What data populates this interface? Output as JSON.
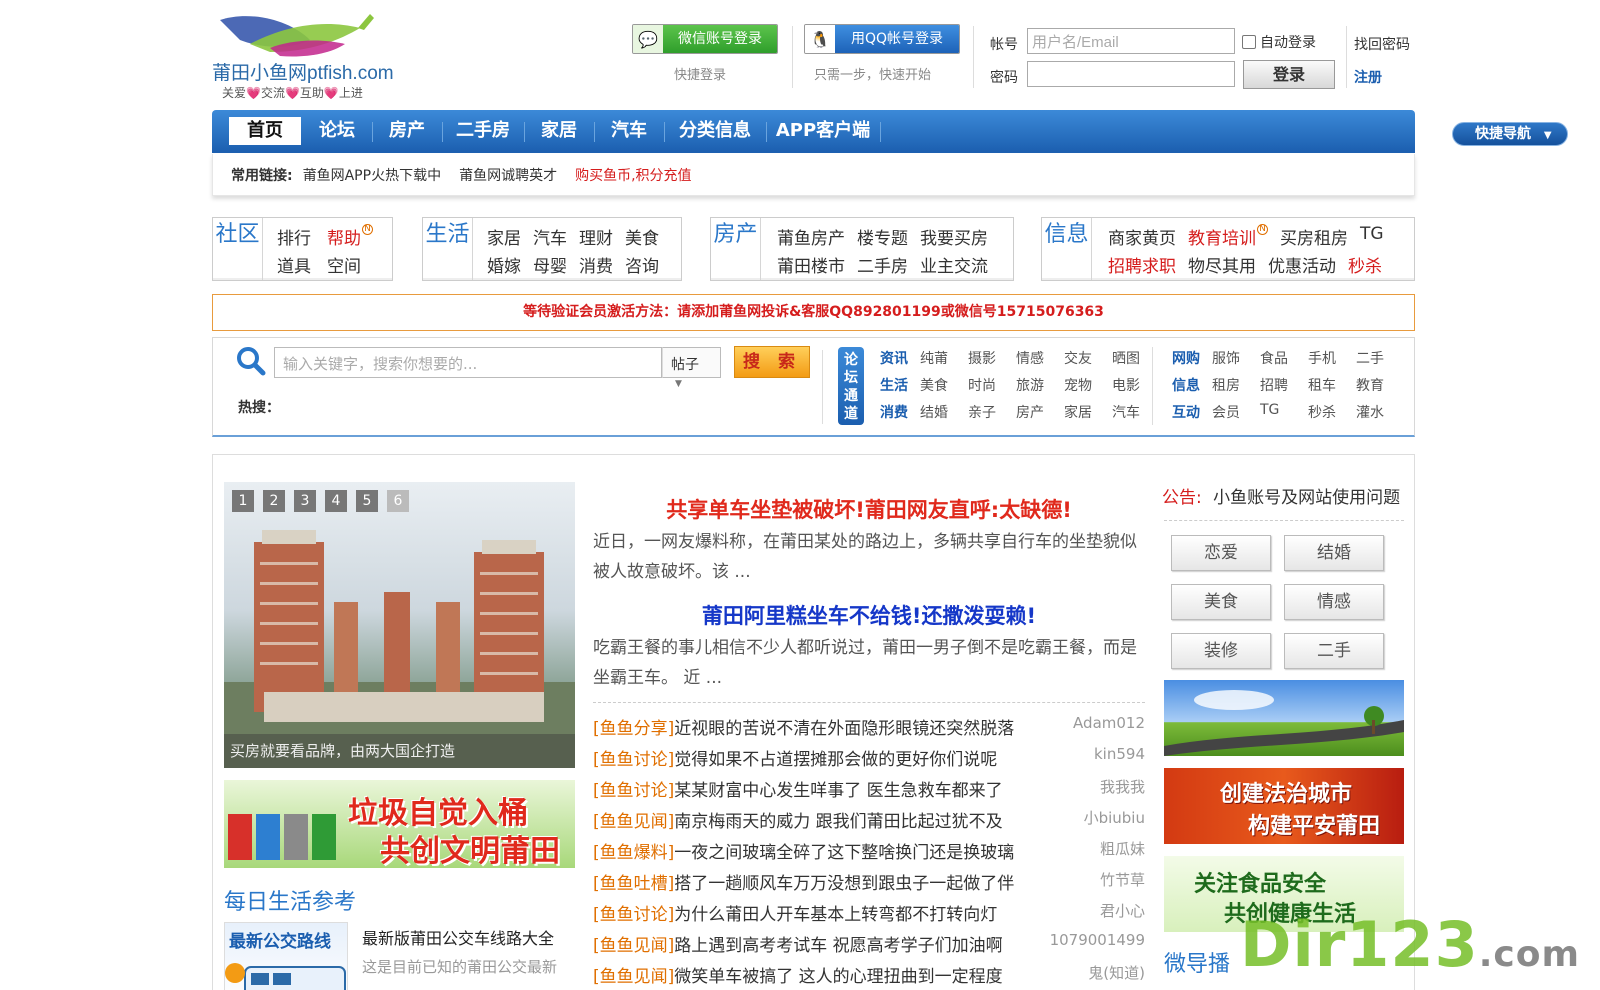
{
  "logo": {
    "text": "莆田小鱼网ptfish.com",
    "slogan": "关爱💗交流💗互助💗上进"
  },
  "login": {
    "wechat_label": "微信账号登录",
    "wechat_hint": "快捷登录",
    "qq_label": "用QQ帐号登录",
    "qq_hint": "只需一步，快速开始",
    "account_label": "帐号",
    "account_placeholder": "用户名/Email",
    "password_label": "密码",
    "auto_login": "自动登录",
    "login_btn": "登录",
    "forgot": "找回密码",
    "register": "注册"
  },
  "nav": {
    "items": [
      "首页",
      "论坛",
      "房产",
      "二手房",
      "家居",
      "汽车",
      "分类信息",
      "APP客户端"
    ],
    "quick_nav": "快捷导航"
  },
  "common_links": {
    "title": "常用链接:",
    "links": [
      "莆鱼网APP火热下载中",
      "莆鱼网诚聘英才",
      "购买鱼币,积分充值"
    ]
  },
  "categories": {
    "community": {
      "head": "社区",
      "row1": [
        "排行",
        "帮助"
      ],
      "row2": [
        "道具",
        "空间"
      ]
    },
    "life": {
      "head": "生活",
      "row1": [
        "家居",
        "汽车",
        "理财",
        "美食"
      ],
      "row2": [
        "婚嫁",
        "母婴",
        "消费",
        "咨询"
      ]
    },
    "estate": {
      "head": "房产",
      "row1": [
        "莆鱼房产",
        "楼专题",
        "我要买房"
      ],
      "row2": [
        "莆田楼市",
        "二手房",
        "业主交流"
      ]
    },
    "info": {
      "head": "信息",
      "row1": [
        "商家黄页",
        "教育培训",
        "买房租房",
        "TG"
      ],
      "row2": [
        "招聘求职",
        "物尽其用",
        "优惠活动",
        "秒杀"
      ]
    }
  },
  "notice": "等待验证会员激活方法：请添加莆鱼网投诉&客服QQ892801199或微信号15715076363",
  "search": {
    "placeholder": "输入关键字，搜索你想要的...",
    "type": "帖子",
    "button": "搜 索",
    "hot_label": "热搜："
  },
  "channel": {
    "label": "论坛通道",
    "rows_left": [
      {
        "key": "资讯",
        "items": [
          "纯莆",
          "摄影",
          "情感",
          "交友",
          "晒图"
        ]
      },
      {
        "key": "生活",
        "items": [
          "美食",
          "时尚",
          "旅游",
          "宠物",
          "电影"
        ]
      },
      {
        "key": "消费",
        "items": [
          "结婚",
          "亲子",
          "房产",
          "家居",
          "汽车"
        ]
      }
    ],
    "rows_right": [
      {
        "key": "网购",
        "items": [
          "服饰",
          "食品",
          "手机",
          "二手"
        ]
      },
      {
        "key": "信息",
        "items": [
          "租房",
          "招聘",
          "租车",
          "教育"
        ]
      },
      {
        "key": "互动",
        "items": [
          "会员",
          "TG",
          "秒杀",
          "灌水"
        ]
      }
    ]
  },
  "slider": {
    "pages": [
      "1",
      "2",
      "3",
      "4",
      "5",
      "6"
    ],
    "caption": "买房就要看品牌，由两大国企打造"
  },
  "banner_garbage": {
    "line1": "垃圾自觉入桶",
    "line2": "共创文明莆田"
  },
  "daily": {
    "title": "每日生活参考",
    "thumb_title": "最新公交路线",
    "item_title": "最新版莆田公交车线路大全",
    "item_desc": "这是目前已知的莆田公交最新"
  },
  "headlines": [
    {
      "title": "共享单车坐垫被破坏!莆田网友直呼:太缺德!",
      "color": "#e0291c",
      "summary": "近日，一网友爆料称，在莆田某处的路边上，多辆共享自行车的坐垫貌似被人故意破坏。该 ..."
    },
    {
      "title": "莆田阿里糕坐车不给钱!还撒泼耍赖!",
      "color": "#1537c8",
      "summary": "吃霸王餐的事儿相信不少人都听说过，莆田一男子倒不是吃霸王餐，而是坐霸王车。 近 ..."
    }
  ],
  "news": [
    {
      "tag": "[鱼鱼分享]",
      "title": "近视眼的苦说不清在外面隐形眼镜还突然脱落",
      "author": "Adam012"
    },
    {
      "tag": "[鱼鱼讨论]",
      "title": "觉得如果不占道摆摊那会做的更好你们说呢",
      "author": "kin594"
    },
    {
      "tag": "[鱼鱼讨论]",
      "title": "某某财富中心发生咩事了 医生急救车都来了",
      "author": "我我我"
    },
    {
      "tag": "[鱼鱼见闻]",
      "title": "南京梅雨天的威力 跟我们莆田比起过犹不及",
      "author": "小biubiu"
    },
    {
      "tag": "[鱼鱼爆料]",
      "title": "一夜之间玻璃全碎了这下整啥换门还是换玻璃",
      "author": "粗瓜妹"
    },
    {
      "tag": "[鱼鱼吐槽]",
      "title": "搭了一趟顺风车万万没想到跟虫子一起做了伴",
      "author": "竹节草"
    },
    {
      "tag": "[鱼鱼讨论]",
      "title": "为什么莆田人开车基本上转弯都不打转向灯",
      "author": "君小心"
    },
    {
      "tag": "[鱼鱼见闻]",
      "title": "路上遇到高考考试车 祝愿高考学子们加油啊",
      "author": "1079001499"
    },
    {
      "tag": "[鱼鱼见闻]",
      "title": "微笑单车被搞了 这人的心理扭曲到一定程度",
      "author": "鬼(知道)"
    }
  ],
  "announce": {
    "label": "公告:",
    "text": "小鱼账号及网站使用问题"
  },
  "tags": [
    "恋爱",
    "结婚",
    "美食",
    "情感",
    "装修",
    "二手"
  ],
  "side_banners": {
    "law_line1": "创建法治城市",
    "law_line2": "构建平安莆田",
    "food_line1": "关注食品安全",
    "food_line2": "共创健康生活"
  },
  "micro_title": "微导播",
  "watermark": {
    "main": "Dir123",
    "suffix": ".com"
  },
  "colors": {
    "nav_blue": "#1b5eaf",
    "red": "#d51d1d",
    "orange_tag": "#e06f00",
    "link_blue": "#2a77c9"
  }
}
